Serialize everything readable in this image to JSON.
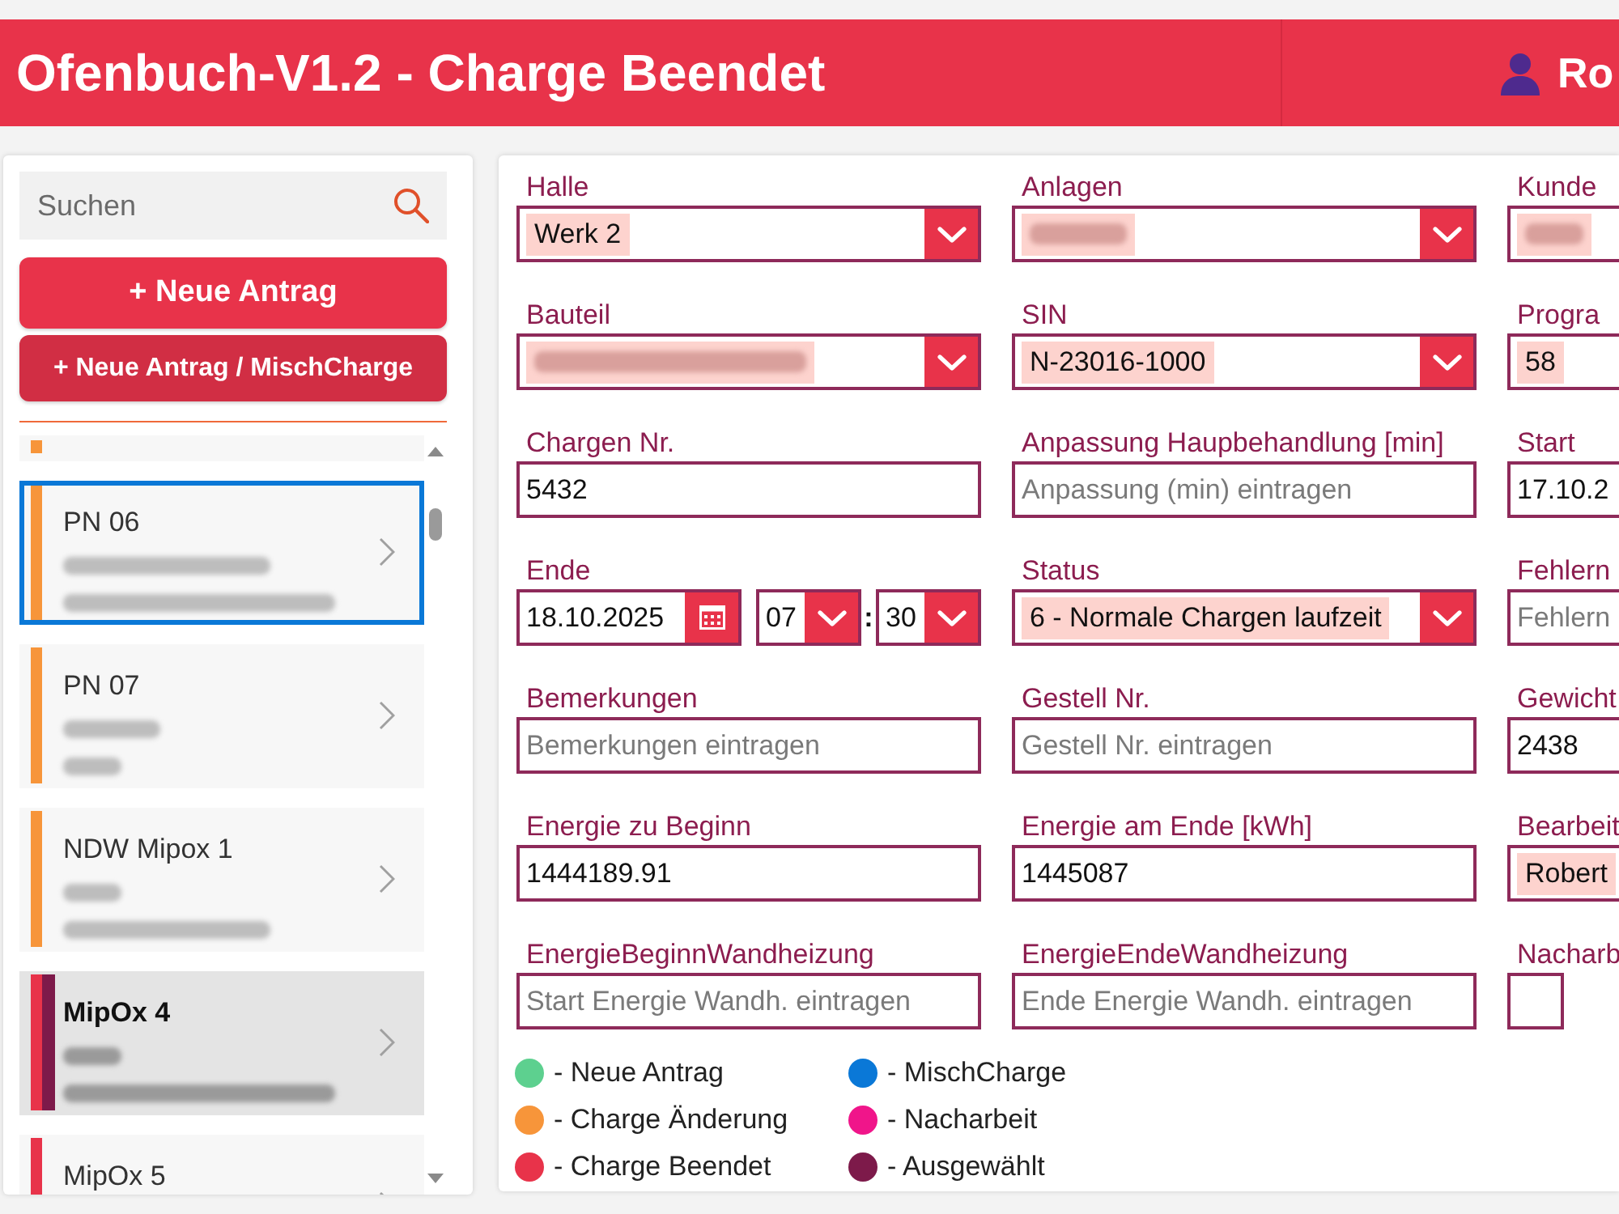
{
  "header": {
    "title": "Ofenbuch-V1.2 - Charge Beendet",
    "user": "Ro"
  },
  "sidebar": {
    "search": {
      "placeholder": "Suchen"
    },
    "buttons": [
      {
        "label": "+ Neue Antrag",
        "kind": "primary"
      },
      {
        "label": "+ Neue Antrag / MischCharge",
        "kind": "secondary"
      }
    ],
    "items": [
      {
        "kind": "clipped",
        "color": "#f7953a",
        "selected": false,
        "focused": false
      },
      {
        "kind": "row",
        "title": "PN 06",
        "details": [
          {
            "kind": "blur-medium"
          },
          {
            "kind": "blur-long"
          }
        ],
        "color": "#f7953a",
        "selected": false,
        "focused": true
      },
      {
        "kind": "row",
        "title": "PN 07",
        "details": [
          {
            "kind": "blur-short"
          },
          {
            "kind": "blur-tiny"
          }
        ],
        "color": "#f7953a",
        "selected": false,
        "focused": false
      },
      {
        "kind": "row",
        "title": "NDW Mipox 1",
        "details": [
          {
            "kind": "blur-tiny"
          },
          {
            "kind": "blur-medium"
          }
        ],
        "color": "#f7953a",
        "selected": false,
        "focused": false
      },
      {
        "kind": "row",
        "title": "MipOx 4",
        "details": [
          {
            "kind": "blur-tiny"
          },
          {
            "kind": "blur-long"
          }
        ],
        "color": "#e8334a",
        "selected": true,
        "focused": false
      },
      {
        "kind": "row",
        "title": "MipOx 5",
        "color": "#e8334a",
        "selected": false,
        "focused": false
      }
    ]
  },
  "form": {
    "fields": [
      {
        "label": "Halle",
        "kind": "dropdown",
        "value": "Werk 2"
      },
      {
        "label": "Anlagen",
        "kind": "dropdown",
        "redacted": {
          "kind": "blur-short"
        }
      },
      {
        "label": "Kunde",
        "kind": "choice",
        "redacted": {
          "kind": "blur-tiny"
        }
      },
      {
        "label": "Bauteil",
        "kind": "dropdown",
        "redacted": {
          "kind": "blur-long"
        }
      },
      {
        "label": "SIN",
        "kind": "dropdown",
        "value": "N-23016-1000"
      },
      {
        "label": "Progra",
        "kind": "choice",
        "value": "58"
      },
      {
        "label": "Chargen Nr.",
        "kind": "text",
        "value": "5432"
      },
      {
        "label": "Anpassung Haupbehandlung [min]",
        "kind": "text",
        "placeholder": "Anpassung (min) eintragen"
      },
      {
        "label": "Start",
        "kind": "text",
        "value": "17.10.2"
      },
      {
        "label": "Ende",
        "kind": "datetime",
        "date": "18.10.2025",
        "hour": "07",
        "separator": ":",
        "minute": "30"
      },
      {
        "label": "Status",
        "kind": "dropdown",
        "value": "6 - Normale Chargen laufzeit"
      },
      {
        "label": "Fehlern",
        "kind": "text",
        "placeholder": "Fehlern"
      },
      {
        "label": "Bemerkungen",
        "kind": "text",
        "placeholder": "Bemerkungen eintragen"
      },
      {
        "label": "Gestell Nr.",
        "kind": "text",
        "placeholder": "Gestell Nr. eintragen"
      },
      {
        "label": "Gewicht",
        "kind": "text",
        "value": "2438"
      },
      {
        "label": "Energie zu Beginn",
        "kind": "text",
        "value": "1444189.91"
      },
      {
        "label": "Energie am Ende [kWh]",
        "kind": "text",
        "value": "1445087"
      },
      {
        "label": "Bearbeit",
        "kind": "choice",
        "value": "Robert"
      },
      {
        "label": "EnergieBeginnWandheizung",
        "kind": "text",
        "placeholder": "Start Energie Wandh. eintragen"
      },
      {
        "label": "EnergieEndeWandheizung",
        "kind": "text",
        "placeholder": "Ende Energie Wandh. eintragen"
      },
      {
        "label": "Nacharb",
        "kind": "checkbox",
        "checked": false
      }
    ]
  },
  "legend": [
    {
      "label": "- Neue Antrag",
      "color": "#5dd08f"
    },
    {
      "label": "- Charge Änderung",
      "color": "#f7953a"
    },
    {
      "label": "- Charge Beendet",
      "color": "#e8334a"
    },
    {
      "label": "- MischCharge",
      "color": "#0a78d7"
    },
    {
      "label": "- Nacharbeit",
      "color": "#f0158a"
    },
    {
      "label": "- Ausgewählt",
      "color": "#7d1a4a"
    }
  ]
}
